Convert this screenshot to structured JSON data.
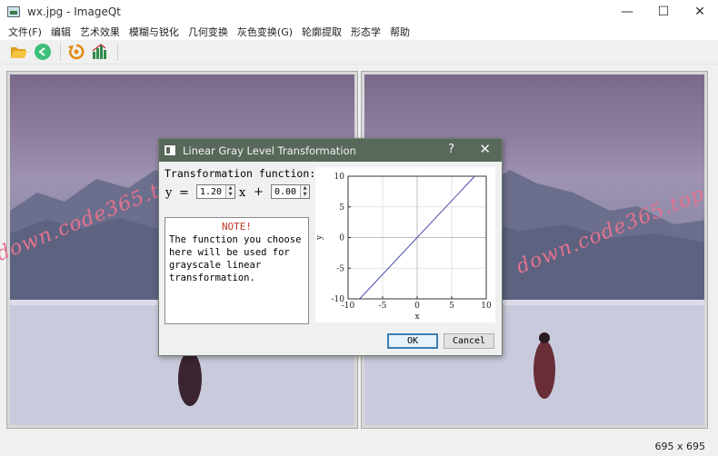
{
  "window": {
    "title": "wx.jpg - ImageQt",
    "minimize_glyph": "—",
    "maximize_glyph": "☐",
    "close_glyph": "✕"
  },
  "menu": {
    "items": [
      {
        "label": "文件(F)"
      },
      {
        "label": "编辑"
      },
      {
        "label": "艺术效果"
      },
      {
        "label": "模糊与锐化"
      },
      {
        "label": "几何变换"
      },
      {
        "label": "灰色变换(G)"
      },
      {
        "label": "轮廓提取"
      },
      {
        "label": "形态学"
      },
      {
        "label": "帮助"
      }
    ]
  },
  "toolbar": {
    "icons": [
      "folder-open-icon",
      "back-icon",
      "reset-icon",
      "histogram-icon"
    ]
  },
  "watermark": {
    "text": "down.code365.top"
  },
  "status": {
    "image_size": "695 x 695"
  },
  "dialog": {
    "title": "Linear Gray Level Transformation",
    "help_glyph": "?",
    "close_glyph": "✕",
    "function_label": "Transformation function:",
    "y_symbol": "y",
    "equals": "=",
    "x_symbol": "x",
    "plus": "+",
    "slope_value": "1.20",
    "intercept_value": "0.00",
    "note_title": "NOTE!",
    "note_lines": [
      "The function you choose",
      "here will be used for",
      "grayscale linear",
      "transformation."
    ],
    "ok_label": "OK",
    "cancel_label": "Cancel"
  },
  "chart_data": {
    "type": "line",
    "xlabel": "x",
    "ylabel": "y",
    "xlim": [
      -10,
      10
    ],
    "ylim": [
      -10,
      10
    ],
    "x_ticks": [
      -10,
      -5,
      0,
      5,
      10
    ],
    "y_ticks": [
      -10,
      -5,
      0,
      5,
      10
    ],
    "grid": true,
    "series": [
      {
        "x": [
          -8.33,
          8.33
        ],
        "y": [
          -10,
          10
        ],
        "color": "#4a4ab0"
      }
    ]
  },
  "colors": {
    "dialog_title_bg": "#58685a",
    "note_title": "#c0392b",
    "watermark": "#e2738f",
    "plot_line": "#4a4ab0"
  }
}
